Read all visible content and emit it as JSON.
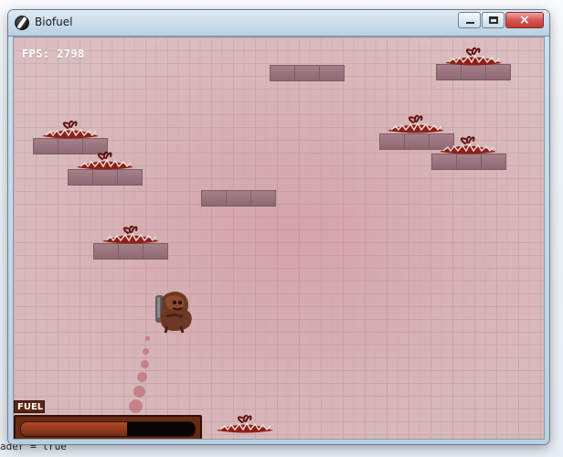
{
  "window": {
    "title": "Biofuel"
  },
  "hud": {
    "fps_label": "FPS: 2798",
    "fuel_label": "FUEL",
    "fuel_level": 0.61
  },
  "background": {
    "code_line": "ader = true"
  },
  "icons": {
    "app": "app-icon",
    "minimize": "minimize-icon",
    "maximize": "maximize-icon",
    "close": "close-icon",
    "player": "jetpack-character-icon",
    "trap": "spiked-trap-icon"
  },
  "colors": {
    "game_bg": "#d7b8bb",
    "platform": "#9f7a84",
    "fuel_bar": "#6a2b14",
    "fuel_fill": "#9d4220"
  }
}
